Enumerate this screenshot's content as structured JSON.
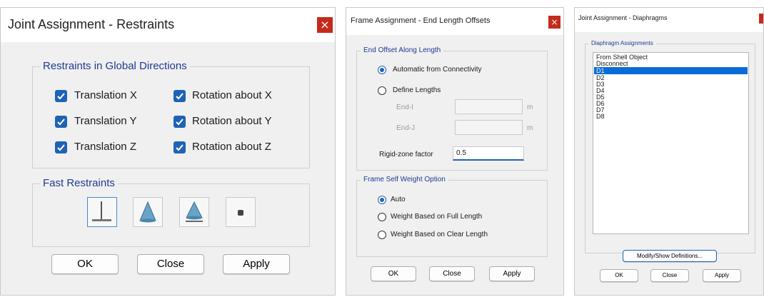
{
  "restraints": {
    "title": "Joint Assignment - Restraints",
    "close_glyph": "×",
    "group_global": "Restraints in Global Directions",
    "checks": [
      {
        "label": "Translation  X",
        "checked": true
      },
      {
        "label": "Rotation about  X",
        "checked": true
      },
      {
        "label": "Translation  Y",
        "checked": true
      },
      {
        "label": "Rotation about  Y",
        "checked": true
      },
      {
        "label": "Translation  Z",
        "checked": true
      },
      {
        "label": "Rotation about  Z",
        "checked": true
      }
    ],
    "group_fast": "Fast Restraints",
    "fast_icons": [
      "fixed-support-icon",
      "pinned-support-icon",
      "roller-support-icon",
      "free-joint-icon"
    ],
    "buttons": {
      "ok": "OK",
      "close": "Close",
      "apply": "Apply"
    }
  },
  "end_offsets": {
    "title": "Frame Assignment - End Length Offsets",
    "close_glyph": "×",
    "group_offset": "End Offset Along Length",
    "radio_auto": "Automatic from Connectivity",
    "radio_define": "Define Lengths",
    "end_i_label": "End-I",
    "end_j_label": "End-J",
    "unit_i": "m",
    "unit_j": "m",
    "end_i_value": "",
    "end_j_value": "",
    "rigid_label": "Rigid-zone factor",
    "rigid_value": "0.5",
    "group_weight": "Frame Self Weight Option",
    "weight_options": [
      "Auto",
      "Weight Based on Full Length",
      "Weight Based on Clear Length"
    ],
    "weight_selected": 0,
    "buttons": {
      "ok": "OK",
      "close": "Close",
      "apply": "Apply"
    }
  },
  "diaphragms": {
    "title": "Joint Assignment - Diaphragms",
    "group": "Diaphragm Assignments",
    "items": [
      "From Shell Object",
      "Disconnect",
      "D1",
      "D2",
      "D3",
      "D4",
      "D5",
      "D6",
      "D7",
      "D8"
    ],
    "selected_index": 2,
    "modify_button": "Modify/Show Definitions...",
    "buttons": {
      "ok": "OK",
      "close": "Close",
      "apply": "Apply"
    }
  },
  "colors": {
    "accent": "#1e63b4",
    "selection": "#0a6cd6",
    "close_red": "#c42b1c",
    "group_title": "#1f3a93"
  }
}
